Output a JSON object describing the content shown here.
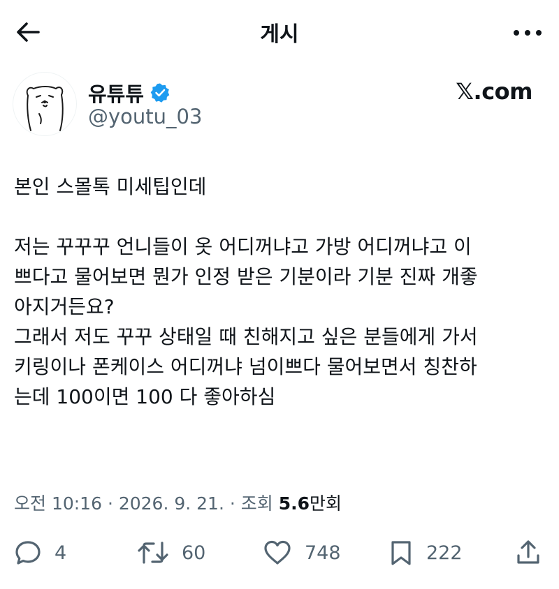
{
  "header": {
    "title": "게시",
    "back_icon": "arrow-left-icon",
    "more_icon": "more-horizontal-icon"
  },
  "author": {
    "name": "유튜튜",
    "handle": "@youtu_03",
    "verified": true,
    "avatar_icon": "bear-avatar"
  },
  "brand": "𝕏.com",
  "post": {
    "text": "본인 스몰톡 미세팁인데\n\n저는 꾸꾸꾸 언니들이 옷 어디꺼냐고 가방 어디꺼냐고 이\n쁘다고 물어보면 뭔가 인정 받은 기분이라 기분 진짜 개좋\n아지거든요?\n그래서 저도 꾸꾸 상태일 때 친해지고 싶은 분들에게 가서\n키링이나 폰케이스 어디꺼냐 넘이쁘다 물어보면서 칭찬하\n는데 100이면 100 다 좋아하심"
  },
  "meta": {
    "timestamp": "오전 10:16 · 2026. 9. 21. · 조회 ",
    "views_count": "5.6",
    "views_unit": "만회"
  },
  "actions": {
    "reply_count": "4",
    "repost_count": "60",
    "like_count": "748",
    "bookmark_count": "222"
  },
  "colors": {
    "text": "#0f1419",
    "secondary": "#536471",
    "verified": "#1d9bf0"
  }
}
